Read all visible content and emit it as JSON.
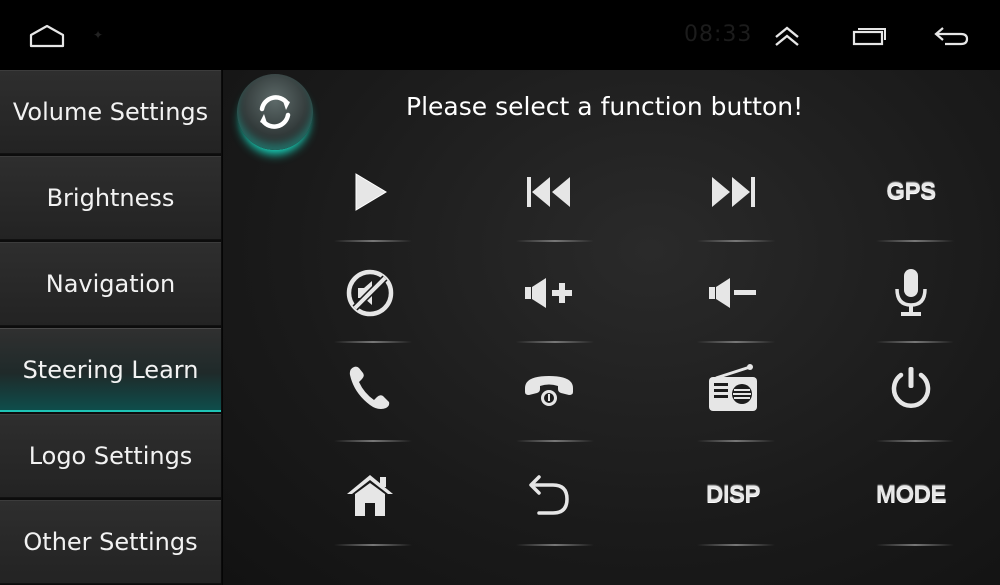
{
  "status_bar": {
    "time": "08:33",
    "icons": [
      "home-icon",
      "notification-dot-icon",
      "chevron-up-icon",
      "recent-apps-icon",
      "back-icon"
    ]
  },
  "sidebar": {
    "items": [
      {
        "label": "Volume Settings",
        "active": false
      },
      {
        "label": "Brightness",
        "active": false
      },
      {
        "label": "Navigation",
        "active": false
      },
      {
        "label": "Steering Learn",
        "active": true
      },
      {
        "label": "Logo Settings",
        "active": false
      },
      {
        "label": "Other Settings",
        "active": false
      }
    ]
  },
  "main": {
    "refresh_icon": "refresh-icon",
    "prompt": "Please select a function button!",
    "buttons": [
      {
        "icon": "play-icon"
      },
      {
        "icon": "previous-track-icon"
      },
      {
        "icon": "next-track-icon"
      },
      {
        "label": "GPS"
      },
      {
        "icon": "mute-icon"
      },
      {
        "icon": "volume-up-icon"
      },
      {
        "icon": "volume-down-icon"
      },
      {
        "icon": "microphone-icon"
      },
      {
        "icon": "phone-answer-icon"
      },
      {
        "icon": "phone-hangup-icon"
      },
      {
        "icon": "radio-icon"
      },
      {
        "icon": "power-icon"
      },
      {
        "icon": "home-icon"
      },
      {
        "icon": "return-icon"
      },
      {
        "label": "DISP"
      },
      {
        "label": "MODE"
      }
    ]
  },
  "colors": {
    "accent": "#1fc4b6",
    "background": "#000000",
    "panel": "#1a1a1a",
    "sidebar_item": "#2a2a2a"
  }
}
